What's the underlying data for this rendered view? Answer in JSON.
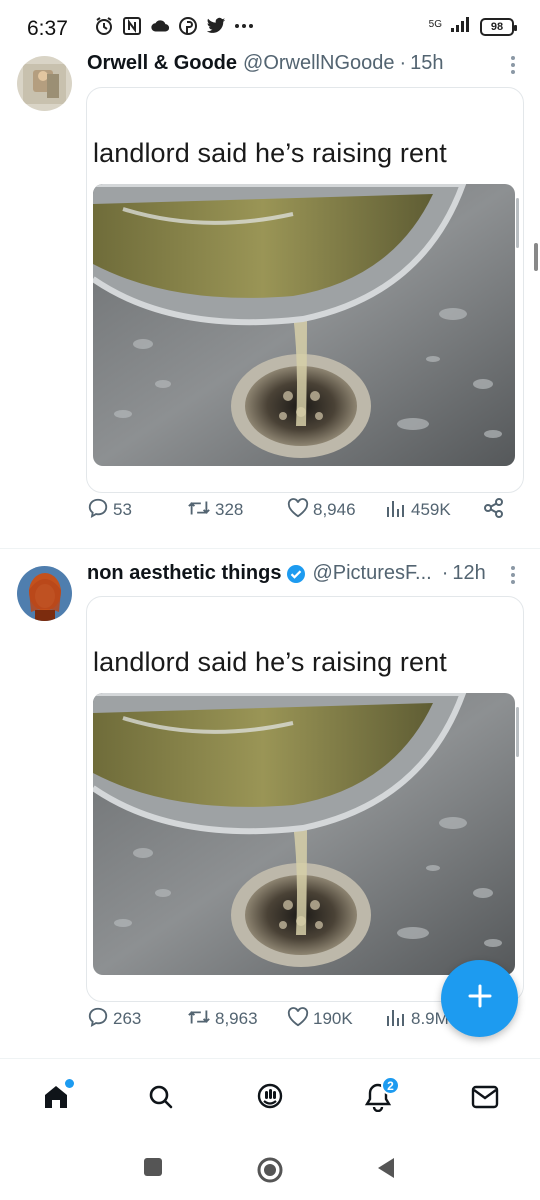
{
  "status_bar": {
    "time": "6:37",
    "network": "5G",
    "battery": "98",
    "icons": [
      "alarm-icon",
      "nfc-icon",
      "cloud-icon",
      "pinterest-icon",
      "twitter-icon",
      "more-notifications-icon"
    ]
  },
  "tweets": [
    {
      "name": "Orwell & Goode",
      "handle": "@OrwellNGoode",
      "dot": "·",
      "time": "15h",
      "verified": false,
      "meme_text": "landlord said he’s raising rent",
      "replies": "53",
      "retweets": "328",
      "likes": "8,946",
      "views": "459K"
    },
    {
      "name": "non aesthetic things",
      "handle": "@PicturesF...",
      "dot": "·",
      "time": "12h",
      "verified": true,
      "meme_text": "landlord said he’s raising rent",
      "replies": "263",
      "retweets": "8,963",
      "likes": "190K",
      "views": "8.9M"
    }
  ],
  "bottom_nav": {
    "items": [
      "home-icon",
      "search-icon",
      "communities-icon",
      "notifications-icon",
      "messages-icon"
    ],
    "notifications_badge": "2"
  },
  "colors": {
    "accent": "#1d9bf0",
    "text_primary": "#0f1419",
    "text_secondary": "#536471"
  }
}
